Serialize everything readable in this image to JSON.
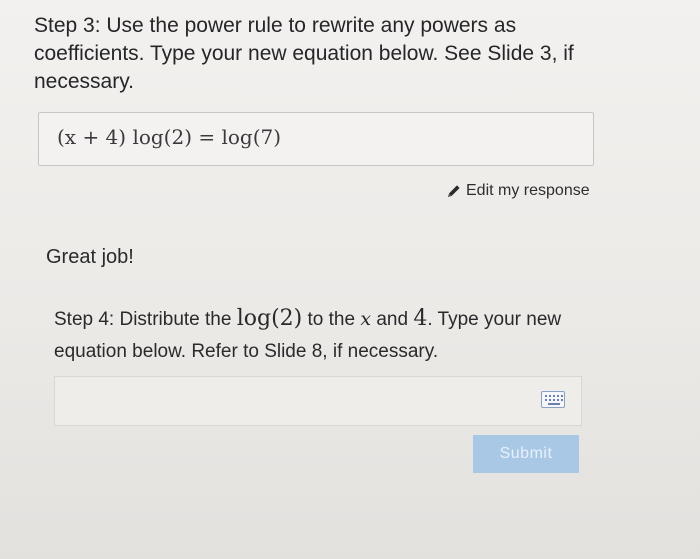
{
  "step3": {
    "instruction": "Step 3: Use the power rule to rewrite any powers as coefficients. Type your new equation below. See Slide 3, if necessary."
  },
  "answer": {
    "equation": "(x + 4) log(2) = log(7)"
  },
  "edit": {
    "icon": "pencil-icon",
    "label": "Edit my response"
  },
  "feedback": {
    "message": "Great job!"
  },
  "step4": {
    "part1": "Step 4: Distribute the ",
    "math1": "log(2)",
    "part2": " to the ",
    "math2": "x",
    "part3": " and ",
    "math3": "4",
    "part4": ". Type your new equation below. Refer to Slide 8, if necessary."
  },
  "input": {
    "value": "",
    "keyboard_icon": "keyboard-icon"
  },
  "submit": {
    "label": "Submit"
  }
}
